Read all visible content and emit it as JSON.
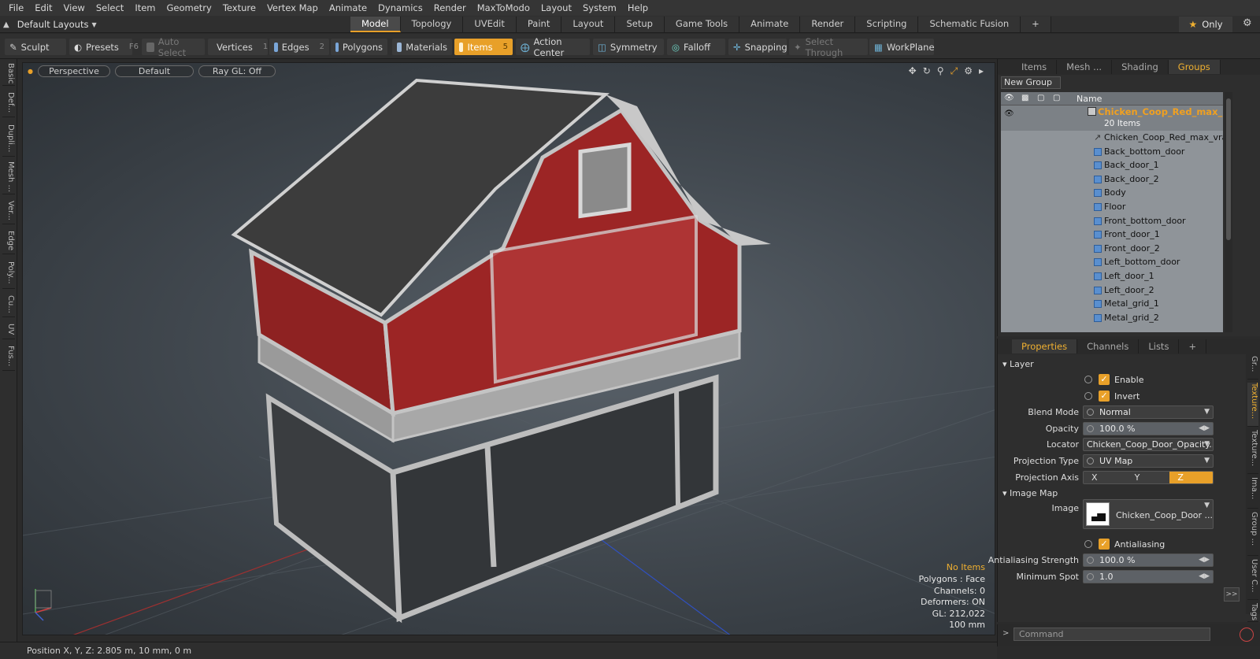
{
  "menu": [
    "File",
    "Edit",
    "View",
    "Select",
    "Item",
    "Geometry",
    "Texture",
    "Vertex Map",
    "Animate",
    "Dynamics",
    "Render",
    "MaxToModo",
    "Layout",
    "System",
    "Help"
  ],
  "layout_select": "Default Layouts",
  "layout_tabs": [
    "Model",
    "Topology",
    "UVEdit",
    "Paint",
    "Layout",
    "Setup",
    "Game Tools",
    "Animate",
    "Render",
    "Scripting",
    "Schematic Fusion"
  ],
  "layout_active": "Model",
  "only_label": "Only",
  "toolbar": {
    "sculpt": "Sculpt",
    "presets": "Presets",
    "presets_key": "F6",
    "auto_select": "Auto Select",
    "vertices": "Vertices",
    "vertices_key": "1",
    "edges": "Edges",
    "edges_key": "2",
    "polygons": "Polygons",
    "materials": "Materials",
    "items": "Items",
    "items_key": "5",
    "action_center": "Action Center",
    "symmetry": "Symmetry",
    "falloff": "Falloff",
    "snapping": "Snapping",
    "select_through": "Select Through",
    "workplane": "WorkPlane"
  },
  "left_tabs": [
    "Basic",
    "Def...",
    "Dupli...",
    "Mesh ...",
    "Ver...",
    "Edge",
    "Poly...",
    "Cu...",
    "UV",
    "Fus..."
  ],
  "viewport": {
    "view": "Perspective",
    "shading": "Default",
    "raygl": "Ray GL: Off",
    "info": {
      "no_items": "No Items",
      "polygons": "Polygons : Face",
      "channels": "Channels: 0",
      "deformers": "Deformers: ON",
      "gl": "GL: 212,022",
      "scale": "100 mm"
    }
  },
  "status": "Position X, Y, Z:  2.805 m, 10 mm, 0 m",
  "right_top": {
    "tabs": [
      "Items",
      "Mesh ...",
      "Shading",
      "Groups"
    ],
    "active_tab": "Groups",
    "new_group": "New Group",
    "col_name": "Name",
    "group_title": "Chicken_Coop_Red_max_...",
    "group_sub": "20 Items",
    "items": [
      "Chicken_Coop_Red_max_vray",
      "Back_bottom_door",
      "Back_door_1",
      "Back_door_2",
      "Body",
      "Floor",
      "Front_bottom_door",
      "Front_door_1",
      "Front_door_2",
      "Left_bottom_door",
      "Left_door_1",
      "Left_door_2",
      "Metal_grid_1",
      "Metal_grid_2"
    ]
  },
  "properties": {
    "tabs": [
      "Properties",
      "Channels",
      "Lists"
    ],
    "active_tab": "Properties",
    "layer_section": "Layer",
    "enable": "Enable",
    "invert": "Invert",
    "blend_mode_label": "Blend Mode",
    "blend_mode": "Normal",
    "opacity_label": "Opacity",
    "opacity": "100.0 %",
    "locator_label": "Locator",
    "locator": "Chicken_Coop_Door_Opacity...",
    "projection_type_label": "Projection Type",
    "projection_type": "UV Map",
    "projection_axis_label": "Projection Axis",
    "axes": [
      "X",
      "Y",
      "Z"
    ],
    "active_axis": "Z",
    "image_map_section": "Image Map",
    "image_label": "Image",
    "image_name": "Chicken_Coop_Door ...",
    "antialiasing": "Antialiasing",
    "aa_strength_label": "Antialiasing Strength",
    "aa_strength": "100.0 %",
    "min_spot_label": "Minimum Spot",
    "min_spot": "1.0",
    "right_tabs": [
      "Gr...",
      "Texture...",
      "Texture...",
      "Ima...",
      "Group ...",
      "User C...",
      "Tags"
    ]
  },
  "command_placeholder": "Command"
}
